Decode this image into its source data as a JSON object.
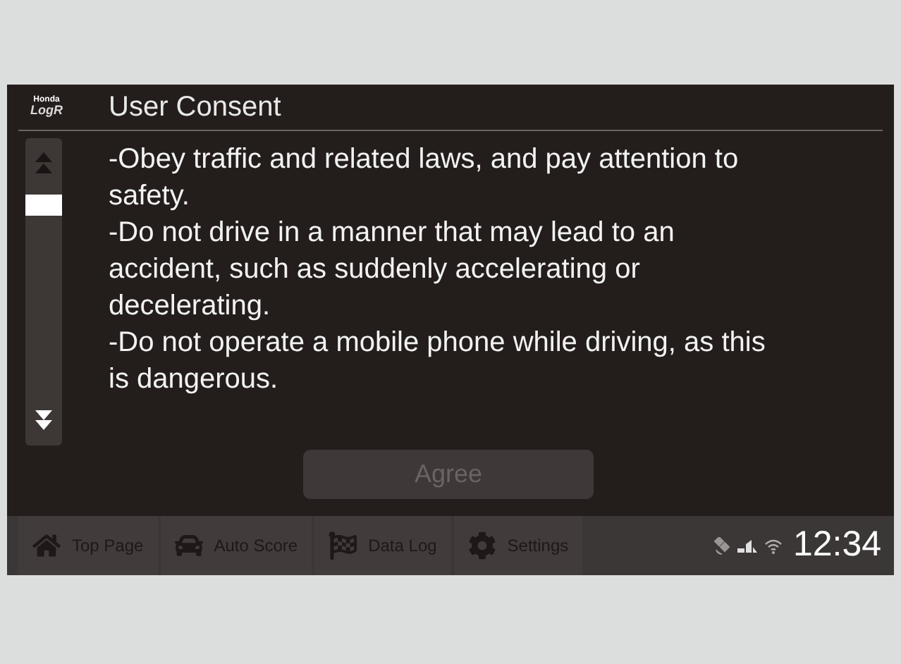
{
  "logo": {
    "maker": "Honda",
    "product": "LogR"
  },
  "title": "User Consent",
  "paragraphs": [
    "-Obey traffic and related laws, and pay attention to safety.",
    "-Do not drive in a manner that may lead to an accident, such as suddenly accelerating or decelerating.",
    "-Do not operate a mobile phone while driving, as this is dangerous."
  ],
  "agree_button": {
    "label": "Agree",
    "disabled": true
  },
  "nav": [
    {
      "kind": "home",
      "label": "Top Page",
      "disabled": true
    },
    {
      "kind": "car",
      "label": "Auto Score",
      "disabled": true
    },
    {
      "kind": "flag",
      "label": "Data Log",
      "disabled": true
    },
    {
      "kind": "gear",
      "label": "Settings",
      "disabled": true
    }
  ],
  "clock": "12:34"
}
